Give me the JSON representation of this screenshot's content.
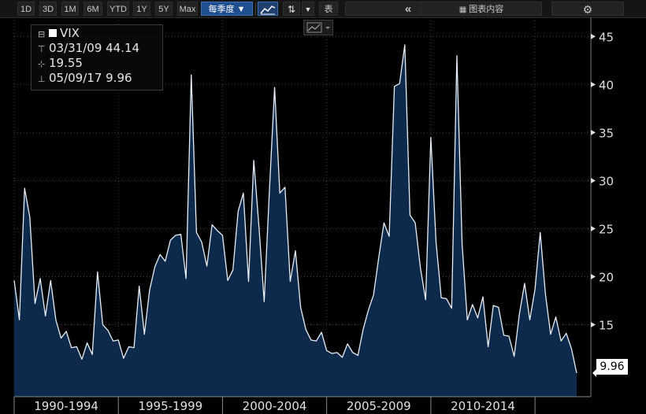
{
  "toolbar": {
    "ranges": [
      "1D",
      "3D",
      "1M",
      "6M",
      "YTD",
      "1Y",
      "5Y",
      "Max"
    ],
    "frequency_label": "每季度 ▼",
    "table_label": "表",
    "collapse_glyph": "«",
    "chart_content_label": "图表内容",
    "settings_glyph": "⚙"
  },
  "legend": {
    "series_name": "VIX",
    "high_row": "03/31/09 44.14",
    "avg_row": "19.55",
    "low_row": "05/09/17 9.96"
  },
  "last_value_label": "9.96",
  "colors": {
    "area_fill": "#0d2a4d",
    "line": "#e8eef5",
    "background": "#000000",
    "grid": "#3a3a3a",
    "active_button": "#1f4f8f"
  },
  "chart_data": {
    "type": "area",
    "title": "",
    "xlabel": "",
    "ylabel": "",
    "frequency": "quarterly",
    "x_start": "1990-Q1",
    "ylim": [
      7.5,
      47
    ],
    "yticks": [
      15,
      20,
      25,
      30,
      35,
      40,
      45
    ],
    "x_tick_labels": [
      "1990-1994",
      "1995-1999",
      "2000-2004",
      "2005-2009",
      "2010-2014"
    ],
    "grid": true,
    "series": [
      {
        "name": "VIX",
        "values": [
          19.6,
          15.5,
          29.2,
          26.2,
          17.2,
          19.8,
          15.9,
          19.6,
          15.5,
          13.6,
          14.3,
          12.6,
          12.7,
          11.4,
          13.1,
          11.9,
          20.5,
          15.0,
          14.4,
          13.3,
          13.4,
          11.5,
          12.7,
          12.6,
          19.0,
          14.0,
          18.6,
          21.0,
          22.3,
          21.6,
          23.8,
          24.3,
          24.4,
          19.8,
          41.0,
          24.6,
          23.6,
          21.1,
          25.4,
          24.8,
          24.3,
          19.6,
          20.7,
          26.8,
          28.7,
          19.5,
          32.1,
          25.2,
          17.4,
          28.9,
          39.7,
          28.7,
          29.3,
          19.5,
          22.7,
          16.8,
          14.5,
          13.4,
          13.3,
          14.2,
          12.3,
          12.0,
          12.1,
          11.6,
          13.0,
          12.1,
          11.8,
          14.5,
          16.5,
          18.1,
          22.0,
          25.6,
          24.2,
          39.8,
          40.1,
          44.14,
          26.4,
          25.6,
          20.9,
          17.6,
          34.5,
          23.6,
          17.8,
          17.7,
          16.7,
          43.0,
          23.4,
          15.5,
          17.1,
          15.7,
          17.9,
          12.7,
          17.0,
          16.8,
          13.9,
          13.8,
          11.7,
          16.1,
          19.3,
          15.5,
          18.7,
          24.6,
          18.2,
          14.0,
          15.8,
          13.3,
          14.1,
          12.5,
          9.96
        ]
      }
    ]
  }
}
